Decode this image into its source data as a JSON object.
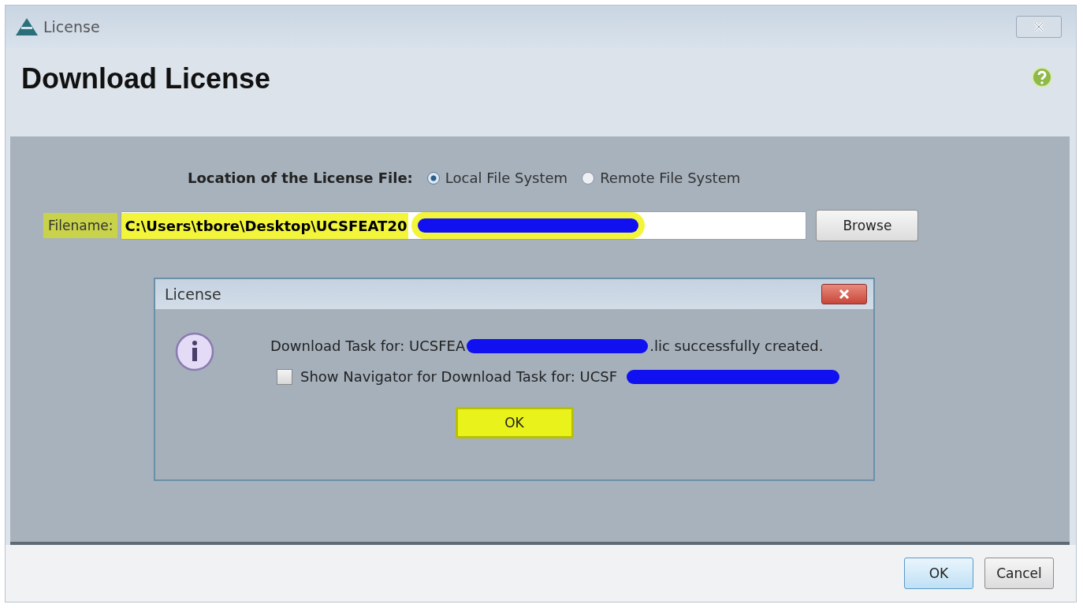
{
  "window": {
    "title": "License"
  },
  "heading": "Download License",
  "location": {
    "label": "Location of the License File:",
    "options": [
      {
        "label": "Local File System",
        "selected": true
      },
      {
        "label": "Remote File System",
        "selected": false
      }
    ]
  },
  "filename": {
    "label": "Filename:",
    "value": "C:\\Users\\tbore\\Desktop\\UCSFEAT20"
  },
  "browse_button": "Browse",
  "dialog": {
    "title": "License",
    "message_start": "Download Task for: UCSFEA",
    "message_end": ".lic successfully created.",
    "checkbox": {
      "label": "Show Navigator for Download Task for: UCSF",
      "checked": false
    },
    "ok_button": "OK"
  },
  "footer_buttons": [
    {
      "label": "OK",
      "kind": "primary"
    },
    {
      "label": "Cancel",
      "kind": "normal"
    }
  ]
}
